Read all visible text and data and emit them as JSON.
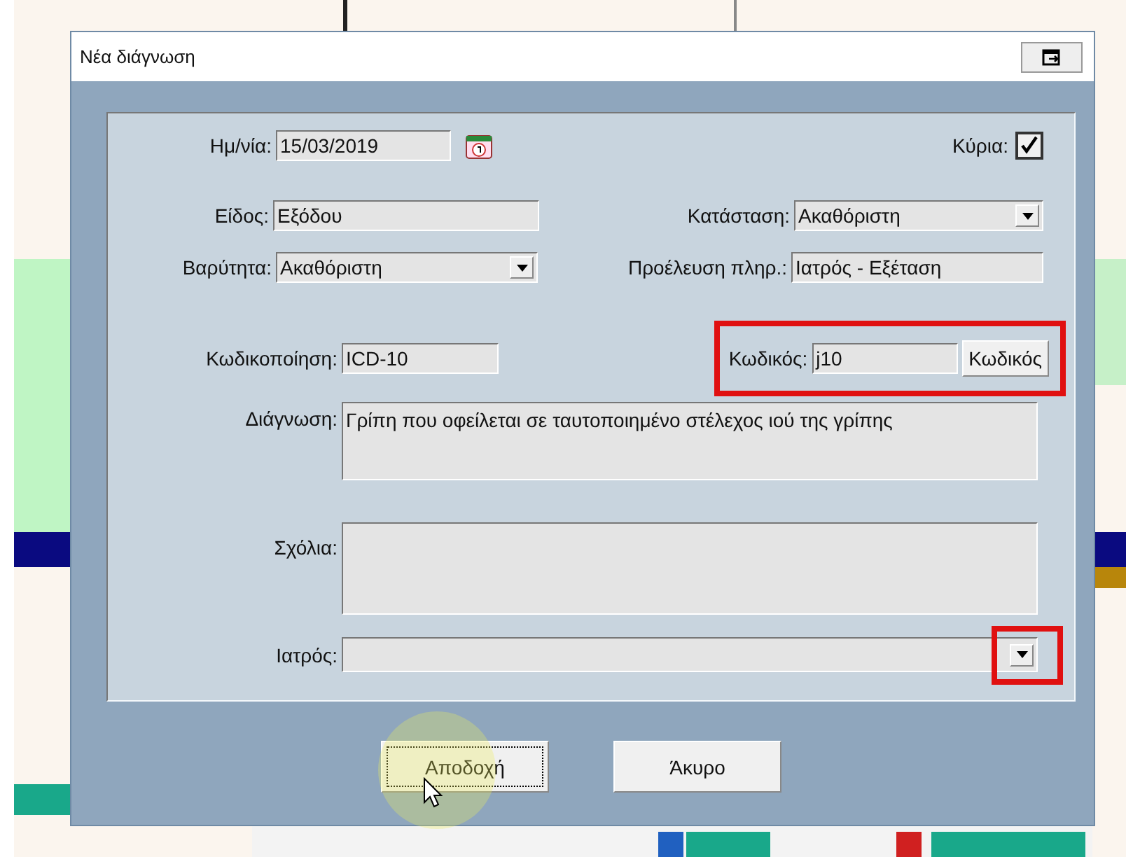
{
  "dialog": {
    "title": "Νέα διάγνωση"
  },
  "date": {
    "label": "Ημ/νία:",
    "value": "15/03/2019"
  },
  "primary": {
    "label": "Κύρια:",
    "checked": true
  },
  "type": {
    "label": "Είδος:",
    "value": "Εξόδου"
  },
  "status": {
    "label": "Κατάσταση:",
    "value": "Ακαθόριστη"
  },
  "severity": {
    "label": "Βαρύτητα:",
    "value": "Ακαθόριστη"
  },
  "source": {
    "label": "Προέλευση πληρ.:",
    "value": "Ιατρός - Εξέταση"
  },
  "coding": {
    "label": "Κωδικοποίηση:",
    "value": "ICD-10"
  },
  "code": {
    "label": "Κωδικός:",
    "value": "j10",
    "button": "Κωδικός",
    "highlighted": true
  },
  "diagnosis": {
    "label": "Διάγνωση:",
    "value": "Γρίπη που οφείλεται σε ταυτοποιημένο στέλεχος ιού της γρίπης"
  },
  "comments": {
    "label": "Σχόλια:"
  },
  "doctor": {
    "label": "Ιατρός:",
    "highlighted": true
  },
  "buttons": [
    {
      "label": "Αποδοχή",
      "focused": true
    },
    {
      "label": "Άκυρο",
      "focused": false
    }
  ]
}
